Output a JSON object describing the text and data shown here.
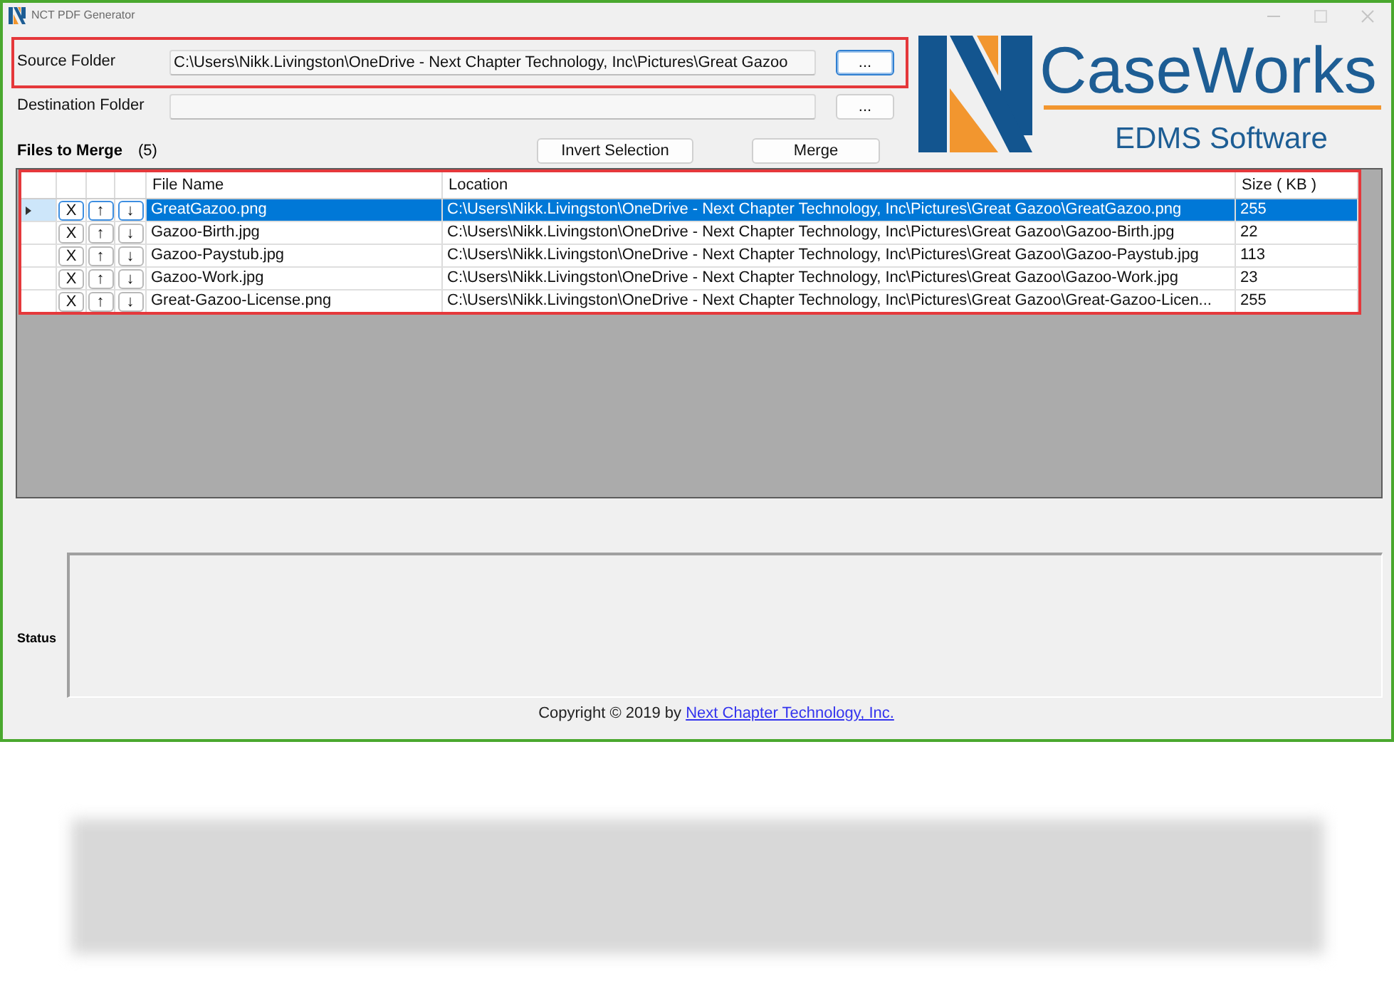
{
  "window": {
    "title": "NCT PDF Generator"
  },
  "source_folder": {
    "label": "Source Folder",
    "value": "C:\\Users\\Nikk.Livingston\\OneDrive - Next Chapter Technology, Inc\\Pictures\\Great Gazoo",
    "browse_button": {
      "label": "...",
      "focused": true
    },
    "highlighted": true
  },
  "logo": {
    "name": "CaseWorks",
    "tagline": "EDMS Software"
  },
  "destination_folder": {
    "label": "Destination Folder",
    "browse_button": {
      "label": "...",
      "focused": false
    }
  },
  "files_to_merge": {
    "label": "Files to Merge",
    "count": "(5)",
    "buttons": [
      "Invert Selection",
      "Merge"
    ]
  },
  "table": {
    "highlighted": true,
    "columns": [
      "File Name",
      "Location",
      "Size ( KB )"
    ],
    "rows": [
      {
        "selected": true,
        "buttons": [
          "X",
          "↑",
          "↓"
        ],
        "file_name": "GreatGazoo.png",
        "location": "C:\\Users\\Nikk.Livingston\\OneDrive - Next Chapter Technology, Inc\\Pictures\\Great Gazoo\\GreatGazoo.png",
        "size": "255"
      },
      {
        "selected": false,
        "buttons": [
          "X",
          "↑",
          "↓"
        ],
        "file_name": "Gazoo-Birth.jpg",
        "location": "C:\\Users\\Nikk.Livingston\\OneDrive - Next Chapter Technology, Inc\\Pictures\\Great Gazoo\\Gazoo-Birth.jpg",
        "size": "22"
      },
      {
        "selected": false,
        "buttons": [
          "X",
          "↑",
          "↓"
        ],
        "file_name": "Gazoo-Paystub.jpg",
        "location": "C:\\Users\\Nikk.Livingston\\OneDrive - Next Chapter Technology, Inc\\Pictures\\Great Gazoo\\Gazoo-Paystub.jpg",
        "size": "113"
      },
      {
        "selected": false,
        "buttons": [
          "X",
          "↑",
          "↓"
        ],
        "file_name": "Gazoo-Work.jpg",
        "location": "C:\\Users\\Nikk.Livingston\\OneDrive - Next Chapter Technology, Inc\\Pictures\\Great Gazoo\\Gazoo-Work.jpg",
        "size": "23"
      },
      {
        "selected": false,
        "buttons": [
          "X",
          "↑",
          "↓"
        ],
        "file_name": "Great-Gazoo-License.png",
        "location": "C:\\Users\\Nikk.Livingston\\OneDrive - Next Chapter Technology, Inc\\Pictures\\Great Gazoo\\Great-Gazoo-Licen...",
        "size": "255"
      }
    ]
  },
  "status": {
    "label": "Status"
  },
  "footer": {
    "text": "Copyright © 2019 by",
    "link": "Next Chapter Technology, Inc."
  }
}
